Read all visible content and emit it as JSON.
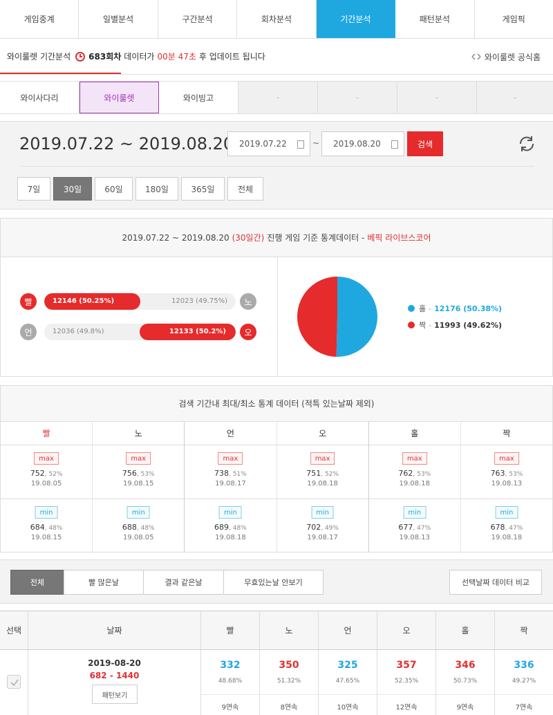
{
  "nav": [
    "게임중계",
    "일별분석",
    "구간분석",
    "회차분석",
    "기간분석",
    "패턴분석",
    "게임픽"
  ],
  "infobar": {
    "title": "와이룰렛 기간분석",
    "round": "683회차",
    "text1": "데이터가",
    "countdown": "00분 47초",
    "text2": "후 업데이트 됩니다",
    "official": "와이룰렛 공식홈"
  },
  "subtabs": [
    "와이사다리",
    "와이룰렛",
    "와이빙고",
    "-",
    "-",
    "-",
    "-"
  ],
  "period": {
    "title": "2019.07.22 ~ 2019.08.20",
    "start": "2019.07.22",
    "tilde": "~",
    "end": "2019.08.20",
    "search": "검색",
    "ranges": [
      "7일",
      "30일",
      "60일",
      "180일",
      "365일",
      "전체"
    ]
  },
  "stats": {
    "head_range": "2019.07.22 ~ 2019.08.20",
    "head_days": "(30일간)",
    "head_text": "진행 게임 기준 통계데이터 -",
    "head_source": "베픽 라이브스코어",
    "row1": {
      "left_label": "빨",
      "left_value": "12146 (50.25%)",
      "right_value": "12023 (49.75%)",
      "right_label": "노",
      "fill": 50.25
    },
    "row2": {
      "left_label": "언",
      "left_value": "12036 (49.8%)",
      "right_value": "12133 (50.2%)",
      "right_label": "오",
      "fill": 50.2
    },
    "legend": [
      {
        "name": "홀",
        "value": "12176 (50.38%)",
        "color": "#1fa8e0"
      },
      {
        "name": "짝",
        "value": "11993 (49.62%)",
        "color": "#e52b2b"
      }
    ]
  },
  "minmax": {
    "head": "검색 기간내 최대/최소 통계 데이터 (적특 있는날짜 제외)",
    "max_badge": "max",
    "min_badge": "min",
    "cols": [
      {
        "name": "빨",
        "color": "#e03030",
        "max_v": "752",
        "max_p": "52%",
        "max_d": "19.08.05",
        "min_v": "684",
        "min_p": "48%",
        "min_d": "19.08.15"
      },
      {
        "name": "노",
        "color": "#333333",
        "max_v": "756",
        "max_p": "53%",
        "max_d": "19.08.15",
        "min_v": "688",
        "min_p": "48%",
        "min_d": "19.08.05"
      },
      {
        "name": "언",
        "color": "#333333",
        "max_v": "738",
        "max_p": "51%",
        "max_d": "19.08.17",
        "min_v": "689",
        "min_p": "48%",
        "min_d": "19.08.18"
      },
      {
        "name": "오",
        "color": "#333333",
        "max_v": "751",
        "max_p": "52%",
        "max_d": "19.08.18",
        "min_v": "702",
        "min_p": "49%",
        "min_d": "19.08.17"
      },
      {
        "name": "홀",
        "color": "#333333",
        "max_v": "762",
        "max_p": "53%",
        "max_d": "19.08.18",
        "min_v": "677",
        "min_p": "47%",
        "min_d": "19.08.13"
      },
      {
        "name": "짝",
        "color": "#333333",
        "max_v": "763",
        "max_p": "53%",
        "max_d": "19.08.13",
        "min_v": "678",
        "min_p": "47%",
        "min_d": "19.08.18"
      }
    ]
  },
  "filter": {
    "buttons": [
      "전체",
      "빨 많은날",
      "결과 같은날",
      "무효있는날 안보기"
    ],
    "compare": "선택날짜 데이터 비교"
  },
  "table": {
    "headers": [
      "선택",
      "날짜",
      "빨",
      "노",
      "언",
      "오",
      "홀",
      "짝"
    ],
    "row": {
      "date": "2019-08-20",
      "range": "682 - 1440",
      "pattern": "패턴보기",
      "cells": [
        {
          "v": "332",
          "p": "48.68%",
          "s": "9연속",
          "c": "blue"
        },
        {
          "v": "350",
          "p": "51.32%",
          "s": "8연속",
          "c": "red"
        },
        {
          "v": "325",
          "p": "47.65%",
          "s": "10연속",
          "c": "blue"
        },
        {
          "v": "357",
          "p": "52.35%",
          "s": "12연속",
          "c": "red"
        },
        {
          "v": "346",
          "p": "50.73%",
          "s": "9연속",
          "c": "red"
        },
        {
          "v": "336",
          "p": "49.27%",
          "s": "7연속",
          "c": "blue"
        }
      ]
    }
  }
}
